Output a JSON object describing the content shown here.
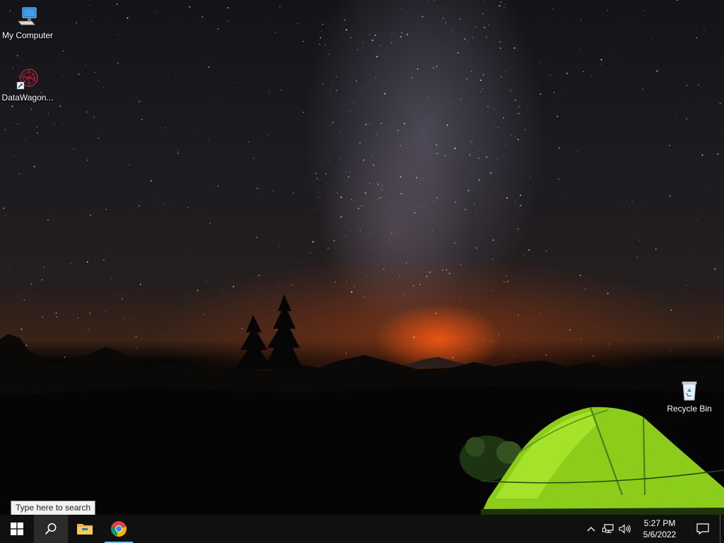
{
  "desktop": {
    "icons": [
      {
        "label": "My Computer",
        "icon": "my-computer-icon"
      },
      {
        "label": "DataWagon...",
        "icon": "datawagon-icon"
      },
      {
        "label": "Recycle Bin",
        "icon": "recycle-bin-icon"
      }
    ]
  },
  "search": {
    "tooltip": "Type here to search"
  },
  "taskbar": {
    "start_icon": "windows-logo-icon",
    "search_icon": "search-icon",
    "pinned": [
      {
        "name": "File Explorer",
        "icon": "file-explorer-icon",
        "active": false
      },
      {
        "name": "Google Chrome",
        "icon": "chrome-icon",
        "active": true
      }
    ],
    "accent_color": "#76b9ed"
  },
  "tray": {
    "icons": [
      "chevron-up-icon",
      "network-icon",
      "volume-icon"
    ],
    "time": "5:27 PM",
    "date": "5/6/2022",
    "notification_icon": "action-center-icon"
  }
}
